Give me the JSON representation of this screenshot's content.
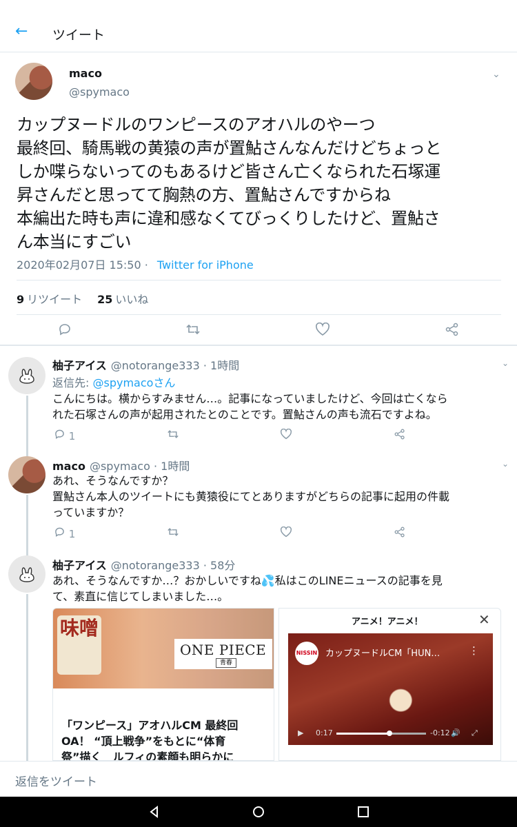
{
  "header": {
    "title": "ツイート"
  },
  "tweet": {
    "name": "maco",
    "handle": "@spymaco",
    "text": "カップヌードルのワンピースのアオハルのやーつ\n最終回、騎馬戦の黄猿の声が置鮎さんなんだけどちょっと\nしか喋らないってのもあるけど皆さん亡くなられた石塚運\n昇さんだと思ってて胸熱の方、置鮎さんですからね\n本編出た時も声に違和感なくてびっくりしたけど、置鮎さ\nん本当にすごい",
    "timestamp": "2020年02月07日 15:50 · ",
    "source": "Twitter for iPhone",
    "retweet_count": "9",
    "retweet_label": "リツイート",
    "like_count": "25",
    "like_label": "いいね"
  },
  "replies": [
    {
      "name": "柚子アイス",
      "meta": "@notorange333 · 1時間",
      "reply_to_label": "返信先: ",
      "reply_to_handle": "@spymacoさん",
      "text": "こんにちは。横からすみません…。記事になっていましたけど、今回は亡くなら\nれた石塚さんの声が起用されたとのことです。置鮎さんの声も流石ですよね。",
      "reply_count": "1"
    },
    {
      "name": "maco",
      "meta": "@spymaco · 1時間",
      "text": "あれ、そうなんですか？\n置鮎さん本人のツイートにも黄猿役にてとありますがどちらの記事に起用の件載\nっていますか？",
      "reply_count": "1"
    },
    {
      "name": "柚子アイス",
      "meta": "@notorange333 · 58分",
      "text": "あれ、そうなんですか…？おかしいですね💦私はこのLINEニュースの記事を見\nて、素直に信じてしまいました…。"
    }
  ],
  "card_left": {
    "image_label": "味噌",
    "brand_title": "ONE PIECE",
    "brand_sub": "青春",
    "title": "「ワンピース」アオハルCM 最終回\nOA！ “頂上戦争”をもとに“体育\n祭”描く　ルフィの素顔も明らかに"
  },
  "card_right": {
    "popup_title": "アニメ！アニメ！",
    "video_logo": "NISSIN",
    "video_title": "カップヌードルCM「HUN…",
    "time_elapsed": "0:17",
    "time_remaining": "-0:12",
    "progress": 0.59
  },
  "reply_bar": {
    "placeholder": "返信をツイート"
  }
}
